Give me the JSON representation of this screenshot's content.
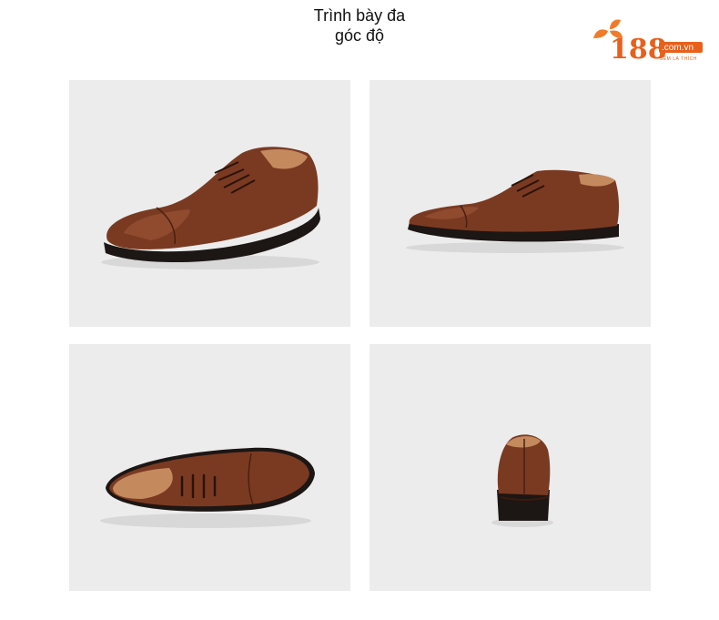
{
  "header": {
    "title_line1": "Trình bày đa",
    "title_line2": "góc độ"
  },
  "logo": {
    "number": "188",
    "domain": ".com.vn",
    "tagline": "SẼM LÀ THÍCH",
    "brand_color": "#e8601c",
    "leaf_color": "#f07b2a"
  },
  "gallery": {
    "panel_color": "#ececec",
    "shoe_colors": {
      "leather": "#7a3a22",
      "leather_light": "#9a5234",
      "sole": "#1c1614",
      "lining": "#c48a5e"
    }
  }
}
